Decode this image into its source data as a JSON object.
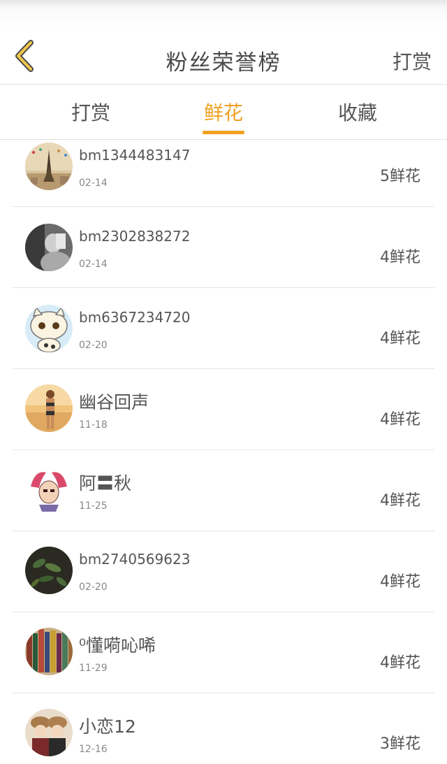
{
  "header": {
    "title": "粉丝荣誉榜",
    "right_action": "打赏"
  },
  "tabs": [
    {
      "label": "打赏",
      "active": false
    },
    {
      "label": "鲜花",
      "active": true
    },
    {
      "label": "收藏",
      "active": false
    }
  ],
  "colors": {
    "accent": "#f0a020",
    "text": "#555555",
    "divider": "#e4e4e4"
  },
  "fans": [
    {
      "name": "bm1344483147",
      "date": "02-14",
      "count": "5鲜花",
      "avatar": "eiffel-tower-avatar"
    },
    {
      "name": "bm2302838272",
      "date": "02-14",
      "count": "4鲜花",
      "avatar": "woman-photo-avatar"
    },
    {
      "name": "bm6367234720",
      "date": "02-20",
      "count": "4鲜花",
      "avatar": "cartoon-cat-avatar"
    },
    {
      "name": "幽谷回声",
      "date": "11-18",
      "count": "4鲜花",
      "avatar": "beach-woman-avatar"
    },
    {
      "name": "阿〓秋",
      "date": "11-25",
      "count": "4鲜花",
      "avatar": "anime-character-avatar"
    },
    {
      "name": "bm2740569623",
      "date": "02-20",
      "count": "4鲜花",
      "avatar": "green-leaves-avatar"
    },
    {
      "name": "⁰懂嗬吣唏",
      "date": "11-29",
      "count": "4鲜花",
      "avatar": "bookshelf-avatar"
    },
    {
      "name": "小恋12",
      "date": "12-16",
      "count": "3鲜花",
      "avatar": "two-girls-avatar"
    }
  ]
}
